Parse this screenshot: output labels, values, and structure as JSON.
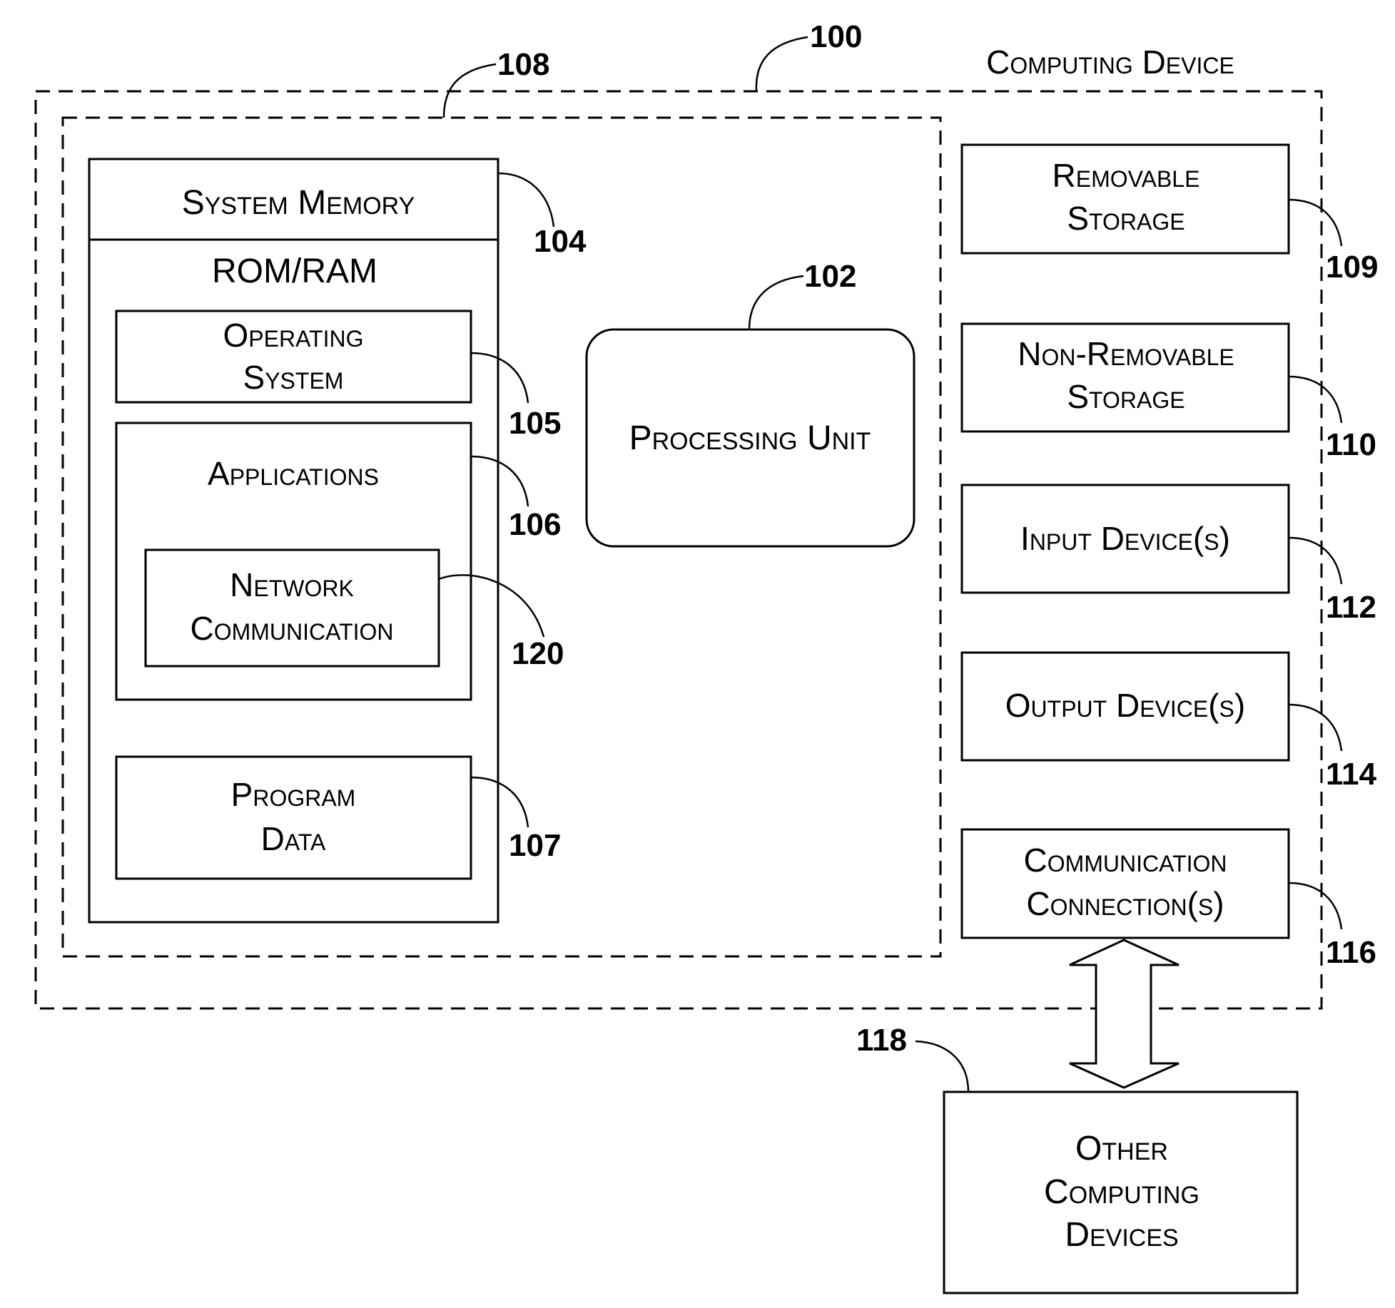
{
  "figure": {
    "title": "Computing Device",
    "refs": {
      "computing_device": "100",
      "inner_group": "108",
      "processing_unit": "102",
      "system_memory": "104",
      "operating_system": "105",
      "applications": "106",
      "program_data": "107",
      "removable_storage": "109",
      "non_removable_storage": "110",
      "input_devices": "112",
      "output_devices": "114",
      "communication_connections": "116",
      "other_computing_devices": "118",
      "network_communication": "120"
    },
    "labels": {
      "system_memory": "System Memory",
      "rom_ram": "ROM/RAM",
      "operating_system": [
        "Operating",
        "System"
      ],
      "applications": "Applications",
      "network_communication": [
        "Network",
        "Communication"
      ],
      "program_data": [
        "Program",
        "Data"
      ],
      "processing_unit": "Processing Unit",
      "removable_storage": [
        "Removable",
        "Storage"
      ],
      "non_removable_storage": [
        "Non-Removable",
        "Storage"
      ],
      "input_devices": "Input Device(s)",
      "output_devices": "Output Device(s)",
      "communication_connections": [
        "Communication",
        "Connection(s)"
      ],
      "other_computing_devices": [
        "Other",
        "Computing",
        "Devices"
      ]
    }
  }
}
